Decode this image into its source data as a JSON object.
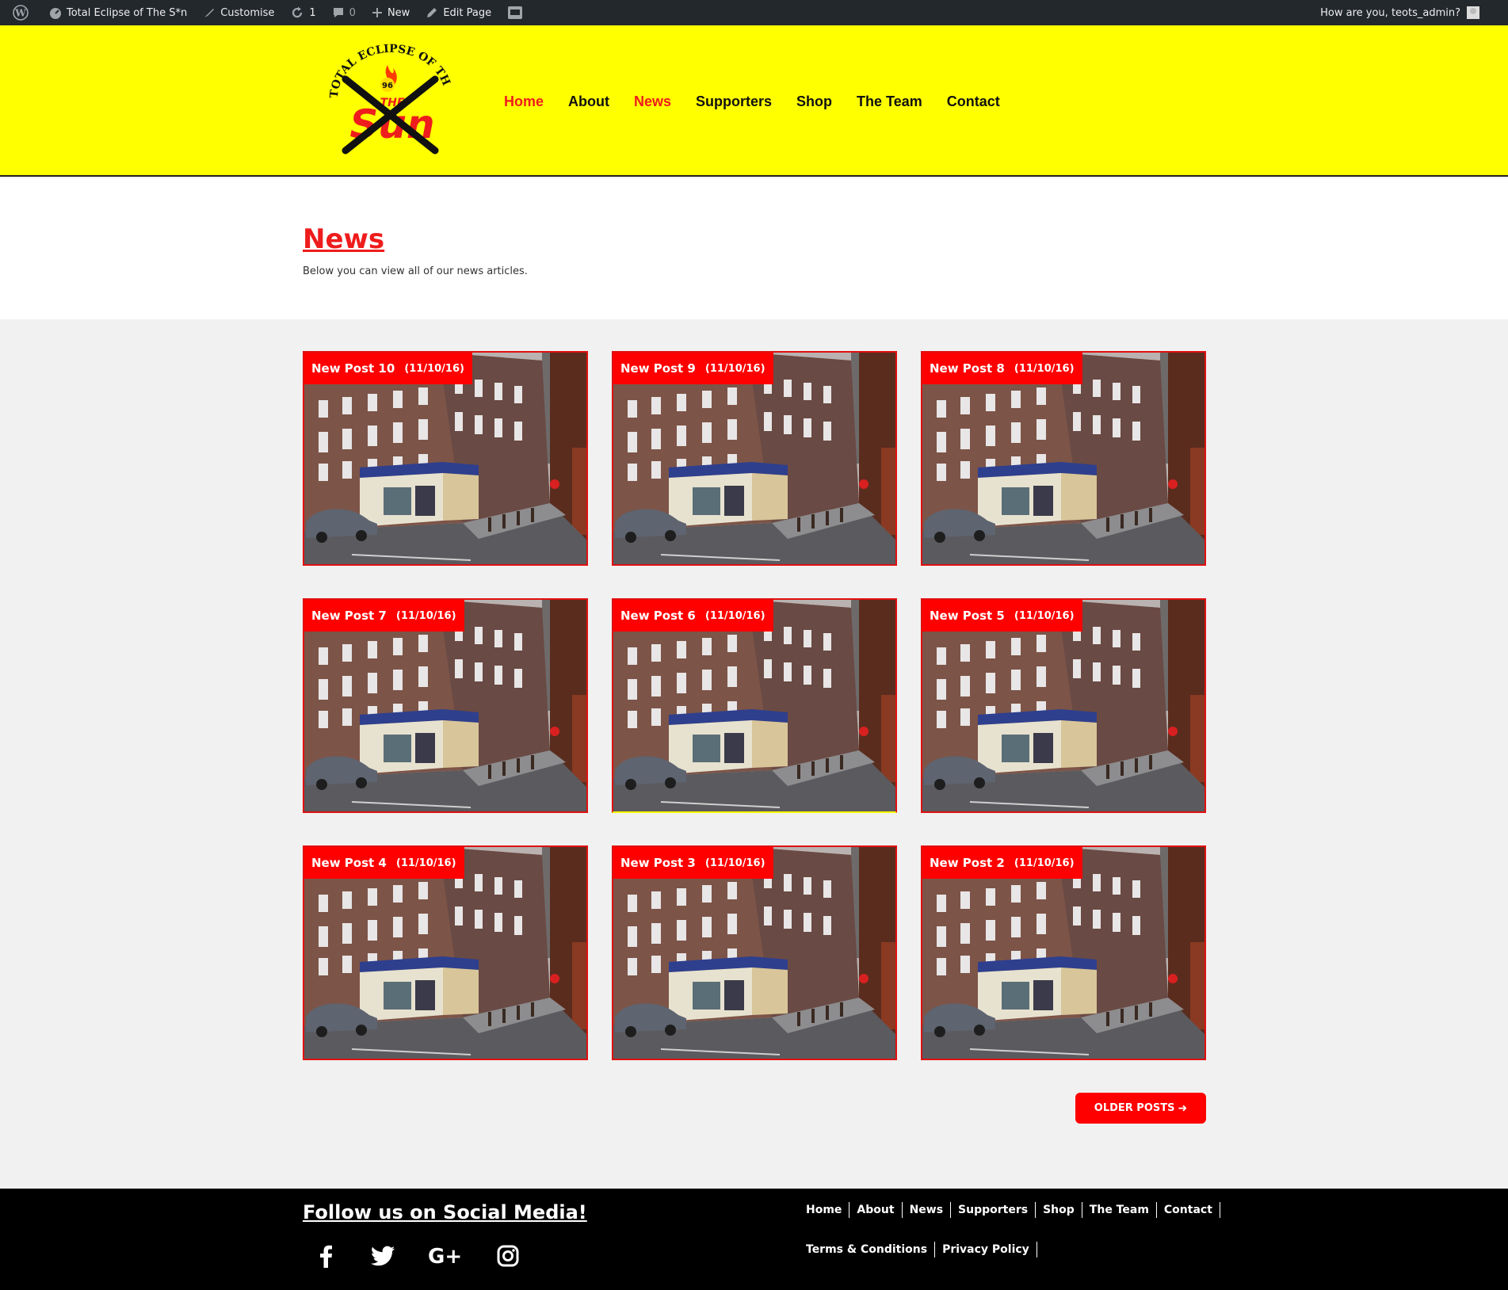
{
  "adminbar": {
    "site_name": "Total Eclipse of The S*n",
    "customise": "Customise",
    "updates_count": "1",
    "comments_count": "0",
    "new": "New",
    "edit_page": "Edit Page",
    "greeting": "How are you, teots_admin?"
  },
  "logo": {
    "ring_text": "TOTAL ECLIPSE OF THE S*N",
    "number": "96",
    "the": "THE",
    "sun": "Sun"
  },
  "nav": {
    "items": [
      "Home",
      "About",
      "News",
      "Supporters",
      "Shop",
      "The Team",
      "Contact"
    ]
  },
  "intro": {
    "title": "News",
    "subtitle": "Below you can view all of our news articles."
  },
  "posts": [
    {
      "title": "New Post 10",
      "date": "(11/10/16)"
    },
    {
      "title": "New Post 9",
      "date": "(11/10/16)"
    },
    {
      "title": "New Post 8",
      "date": "(11/10/16)"
    },
    {
      "title": "New Post 7",
      "date": "(11/10/16)"
    },
    {
      "title": "New Post 6",
      "date": "(11/10/16)"
    },
    {
      "title": "New Post 5",
      "date": "(11/10/16)"
    },
    {
      "title": "New Post 4",
      "date": "(11/10/16)"
    },
    {
      "title": "New Post 3",
      "date": "(11/10/16)"
    },
    {
      "title": "New Post 2",
      "date": "(11/10/16)"
    }
  ],
  "older_posts": "OLDER POSTS",
  "footer": {
    "heading": "Follow us on Social Media!",
    "social": [
      "facebook-icon",
      "twitter-icon",
      "google-plus-icon",
      "instagram-icon"
    ],
    "nav": [
      "Home",
      "About",
      "News",
      "Supporters",
      "Shop",
      "The Team",
      "Contact"
    ],
    "legal": [
      "Terms & Conditions",
      "Privacy Policy"
    ]
  },
  "colors": {
    "brand_yellow": "#ffff00",
    "brand_red": "#ff0000",
    "admin_bar": "#23282d"
  }
}
